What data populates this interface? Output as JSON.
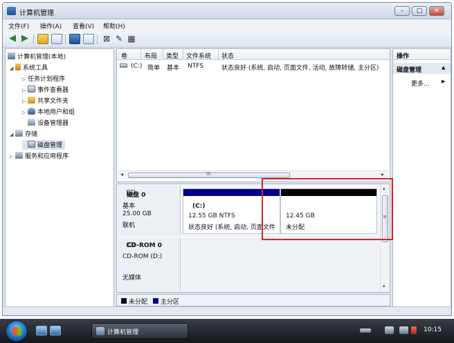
{
  "window": {
    "title": "计算机管理",
    "min_label": "–",
    "max_label": "□",
    "close_label": "✕"
  },
  "menu": [
    "文件(F)",
    "操作(A)",
    "查看(V)",
    "帮助(H)"
  ],
  "tree": [
    {
      "label": "计算机管理(本地)",
      "exp": "",
      "icon": "computer-management-icon"
    },
    {
      "label": "系统工具",
      "exp": "◢",
      "icon": "system-tools-icon"
    },
    {
      "label": "任务计划程序",
      "exp": "▷",
      "icon": "task-scheduler-icon"
    },
    {
      "label": "事件查看器",
      "exp": "▷",
      "icon": "event-viewer-icon"
    },
    {
      "label": "共享文件夹",
      "exp": "▷",
      "icon": "shared-folders-icon"
    },
    {
      "label": "本地用户和组",
      "exp": "▷",
      "icon": "local-users-icon"
    },
    {
      "label": "设备管理器",
      "exp": "",
      "icon": "device-manager-icon"
    },
    {
      "label": "存储",
      "exp": "◢",
      "icon": "storage-icon"
    },
    {
      "label": "磁盘管理",
      "exp": "",
      "icon": "disk-management-icon"
    },
    {
      "label": "服务和应用程序",
      "exp": "▷",
      "icon": "services-icon"
    }
  ],
  "volumes": {
    "columns": [
      "卷",
      "布局",
      "类型",
      "文件系统",
      "状态"
    ],
    "rows": [
      {
        "volume": "(C:)",
        "layout": "简单",
        "type": "基本",
        "fs": "NTFS",
        "status": "状态良好 (系统, 启动, 页面文件, 活动, 故障转储, 主分区)"
      }
    ],
    "scroll_grip": "III"
  },
  "disks": [
    {
      "name": "磁盘 0",
      "type": "基本",
      "size": "25.00 GB",
      "state": "联机",
      "partitions": [
        {
          "label": "(C:)",
          "size": "12.55 GB NTFS",
          "status": "状态良好 (系统, 启动, 页面文件",
          "color": "#00008b"
        },
        {
          "label": "",
          "size": "12.45 GB",
          "status": "未分配",
          "color": "#000000"
        }
      ]
    },
    {
      "name": "CD-ROM 0",
      "type": "CD-ROM (D:)",
      "state": "无媒体"
    }
  ],
  "legend": [
    {
      "label": "未分配",
      "color": "#000000"
    },
    {
      "label": "主分区",
      "color": "#00008b"
    }
  ],
  "actions": {
    "header": "操作",
    "section": "磁盘管理",
    "section_arrow": "▲",
    "more": "更多...",
    "more_arrow": "▶"
  },
  "taskbar": {
    "task_label": "计算机管理",
    "clock": "10:15"
  },
  "colors": {
    "highlight": "#dd2222",
    "primary_partition": "#00008b",
    "unallocated": "#000000"
  }
}
